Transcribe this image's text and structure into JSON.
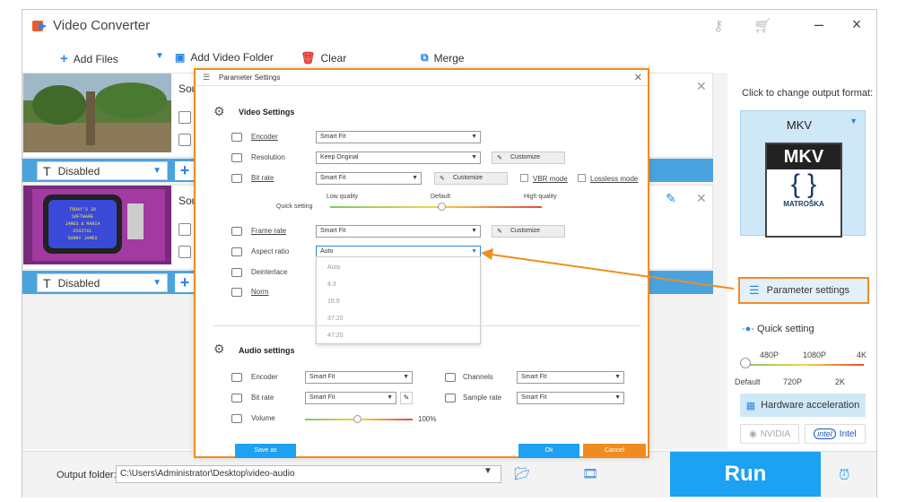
{
  "app": {
    "title": "Video Converter"
  },
  "toolbar": {
    "add_files": "Add Files",
    "add_folder": "Add Video Folder",
    "clear": "Clear",
    "merge": "Merge"
  },
  "items": [
    {
      "source_prefix": "Sou",
      "subtitle": "Disabled"
    },
    {
      "source_prefix": "Sou",
      "subtitle": "Disabled"
    }
  ],
  "tv_text": [
    "TODAY'S 3D",
    "SOFTWARE",
    "JAMES & MARIA",
    "DIGITAL",
    "SUNNY JAMES"
  ],
  "right": {
    "format_label": "Click to change output format:",
    "format": "MKV",
    "icon_text": "MKV",
    "icon_brand": "MATROŠKA",
    "param_button": "Parameter settings",
    "quick_setting": "Quick setting",
    "qs_top": [
      "480P",
      "1080P",
      "4K"
    ],
    "qs_bottom": [
      "Default",
      "720P",
      "2K"
    ],
    "hw_button": "Hardware acceleration",
    "nvidia": "NVIDIA",
    "intel": "Intel",
    "intel_logo": "intel"
  },
  "bottom": {
    "output_label": "Output folder:",
    "output_path": "C:\\Users\\Administrator\\Desktop\\video-audio",
    "run": "Run"
  },
  "dialog": {
    "title": "Parameter Settings",
    "video_section": "Video Settings",
    "encoder_label": "Encoder",
    "encoder_value": "Smart Fit",
    "resolution_label": "Resolution",
    "resolution_value": "Keep Original",
    "customize": "Customize",
    "bitrate_label": "Bit rate",
    "bitrate_value": "Smart Fit",
    "vbr_label": "VBR mode",
    "lossless_label": "Lossless mode",
    "quick_label": "Quick setting",
    "quality_low": "Low quality",
    "quality_default": "Default",
    "quality_high": "High quality",
    "framerate_label": "Frame rate",
    "framerate_value": "Smart Fit",
    "aspect_label": "Aspect ratio",
    "aspect_value": "Auto",
    "aspect_options": [
      "Auto",
      "4:3",
      "16:9",
      "37:20",
      "47:20"
    ],
    "deinterlace_label": "Deinterlace",
    "norm_label": "Norm",
    "audio_section": "Audio settings",
    "a_encoder_label": "Encoder",
    "a_encoder_value": "Smart Fit",
    "a_bitrate_label": "Bit rate",
    "a_bitrate_value": "Smart Fit",
    "channels_label": "Channels",
    "channels_value": "Smart Fit",
    "samplerate_label": "Sample rate",
    "samplerate_value": "Smart Fit",
    "volume_label": "Volume",
    "volume_value": "100%",
    "save_as": "Save as",
    "ok": "Ok",
    "cancel": "Cancel"
  },
  "colors": {
    "accent": "#1da1f2",
    "highlight": "#f08c1f",
    "subbar": "#4aa3df"
  }
}
